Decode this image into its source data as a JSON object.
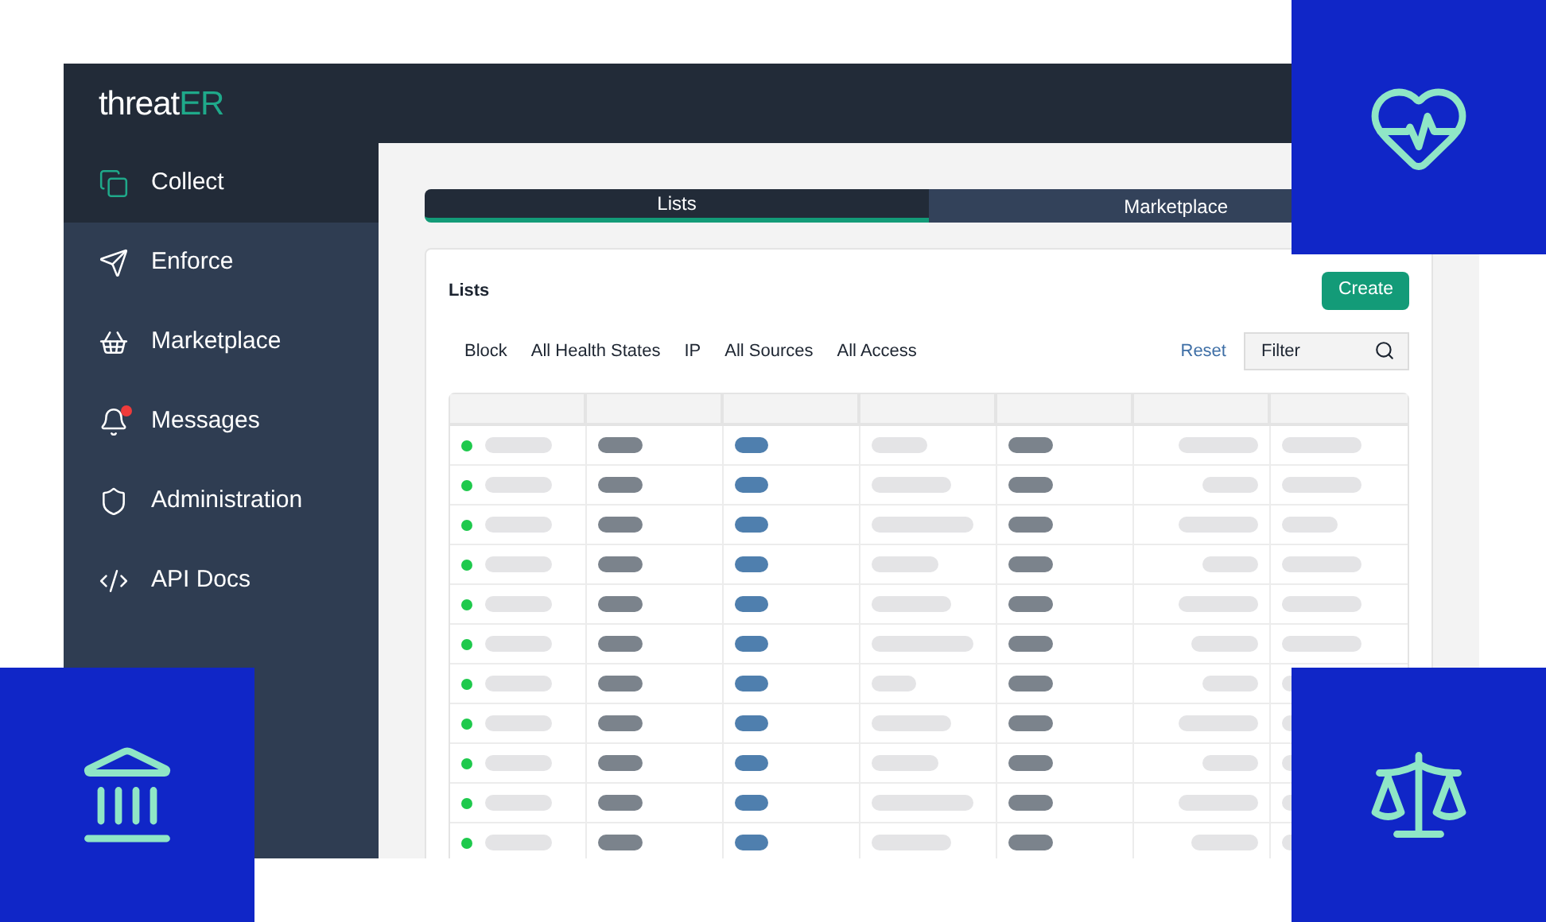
{
  "logo": {
    "text": "threat",
    "accent": "ER"
  },
  "sidebar": {
    "items": [
      {
        "label": "Collect",
        "selected": true,
        "notification": false
      },
      {
        "label": "Enforce",
        "selected": false,
        "notification": false
      },
      {
        "label": "Marketplace",
        "selected": false,
        "notification": false
      },
      {
        "label": "Messages",
        "selected": false,
        "notification": true
      },
      {
        "label": "Administration",
        "selected": false,
        "notification": false
      },
      {
        "label": "API Docs",
        "selected": false,
        "notification": false
      }
    ]
  },
  "tabs": [
    {
      "label": "Lists",
      "selected": true
    },
    {
      "label": "Marketplace",
      "selected": false
    }
  ],
  "card": {
    "title": "Lists",
    "create_button": "Create",
    "filters": [
      "Block",
      "All Health States",
      "IP",
      "All Sources",
      "All Access"
    ],
    "reset": "Reset",
    "filter_field": {
      "placeholder": "Filter"
    }
  },
  "table": {
    "rows": [
      {
        "color": "#1ec94c"
      },
      {
        "color": "#1ec94c"
      },
      {
        "color": "#1ec94c"
      },
      {
        "color": "#1ec94c"
      },
      {
        "color": "#1ec94c"
      },
      {
        "color": "#1ec94c"
      },
      {
        "color": "#1ec94c"
      },
      {
        "color": "#1ec94c"
      },
      {
        "color": "#1ec94c"
      },
      {
        "color": "#1ec94c"
      },
      {
        "color": "#1ec94c"
      }
    ]
  }
}
